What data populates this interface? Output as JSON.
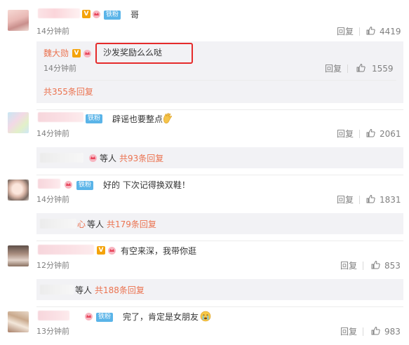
{
  "comments": [
    {
      "fan_label": "铁粉",
      "text": "哥",
      "time": "14分钟前",
      "reply_label": "回复",
      "likes": "4419",
      "badge_v": "V",
      "sub_reply": {
        "name": "魏大勋",
        "badge_v": "V",
        "text": "沙发奖励么么哒",
        "time": "14分钟前",
        "reply_label": "回复",
        "likes": "1559"
      },
      "total_replies": "共355条回复"
    },
    {
      "fan_label": "铁粉",
      "text": "辟谣也要整点",
      "time": "14分钟前",
      "reply_label": "回复",
      "likes": "2061",
      "others_label": "等人",
      "total_replies": "共93条回复"
    },
    {
      "fan_label": "铁粉",
      "text": "好的 下次记得换双鞋！",
      "time": "14分钟前",
      "reply_label": "回复",
      "likes": "1831",
      "suffix_char": "心",
      "others_label": "等人",
      "total_replies": "共179条回复"
    },
    {
      "badge_v": "V",
      "text": "有空来深，我带你逛",
      "time": "12分钟前",
      "reply_label": "回复",
      "likes": "853",
      "others_label": "等人",
      "total_replies": "共188条回复"
    },
    {
      "fan_label": "铁粉",
      "text": "完了，肯定是女朋友",
      "time": "13分钟前",
      "reply_label": "回复",
      "likes": "983"
    }
  ],
  "icons": {
    "thumb": "thumbs-up-icon",
    "crown": "crown-icon",
    "hand_emoji": "ok-hand-emoji",
    "cry_emoji": "crying-face-emoji"
  },
  "colors": {
    "highlight_border": "#e52b2b",
    "link_orange": "#eb7350",
    "fan_badge": "#5ab4e8",
    "v_badge": "#f4a30a"
  }
}
